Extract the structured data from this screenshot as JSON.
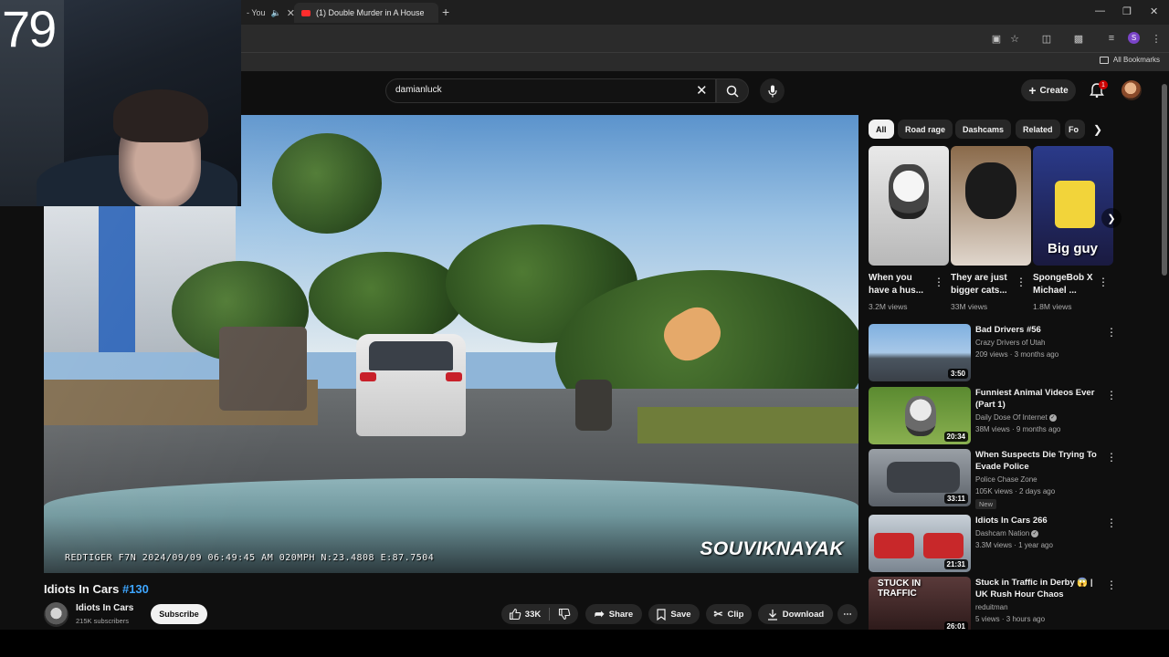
{
  "browser": {
    "tabs": [
      {
        "label": "- You"
      },
      {
        "label": "(1) Double Murder in A House"
      }
    ],
    "new_tab": "+",
    "bookmarks_label": "All Bookmarks",
    "profile_initial": "S"
  },
  "webcam": {
    "counter": "79"
  },
  "header": {
    "search_value": "damianluck",
    "create_label": "Create",
    "notification_count": "1"
  },
  "video": {
    "osd_text": "REDTIGER F7N 2024/09/09 06:49:45 AM 020MPH N:23.4808 E:87.7504",
    "watermark": "SOUVIKNAYAK",
    "title": "Idiots In Cars ",
    "title_tag": "#130",
    "channel": "Idiots In Cars",
    "subscribers": "215K subscribers",
    "subscribe_label": "Subscribe",
    "likes": "33K",
    "share_label": "Share",
    "save_label": "Save",
    "clip_label": "Clip",
    "download_label": "Download"
  },
  "chips": [
    "All",
    "Road rage",
    "Dashcams",
    "Related",
    "Fo"
  ],
  "shorts": [
    {
      "title": "When you have a hus...",
      "views": "3.2M views",
      "overlay": ""
    },
    {
      "title": "They are just bigger cats...",
      "views": "33M views",
      "overlay": ""
    },
    {
      "title": "SpongeBob X Michael ...",
      "views": "1.8M views",
      "overlay": "Big guy"
    }
  ],
  "recommendations": [
    {
      "title": "Bad Drivers #56",
      "channel": "Crazy Drivers of Utah",
      "meta": "209 views · 3 months ago",
      "duration": "3:50",
      "verified": false,
      "is_new": false
    },
    {
      "title": "Funniest Animal Videos Ever (Part 1)",
      "channel": "Daily Dose Of Internet",
      "meta": "38M views · 9 months ago",
      "duration": "20:34",
      "verified": true,
      "is_new": false
    },
    {
      "title": "When Suspects Die Trying To Evade Police",
      "channel": "Police Chase Zone",
      "meta": "105K views · 2 days ago",
      "duration": "33:11",
      "verified": false,
      "is_new": true,
      "new_label": "New"
    },
    {
      "title": "Idiots In Cars 266",
      "channel": "Dashcam Nation",
      "meta": "3.3M views · 1 year ago",
      "duration": "21:31",
      "verified": true,
      "is_new": false
    },
    {
      "title": "Stuck in Traffic in Derby 😱 | UK Rush Hour Chaos",
      "channel": "reduitman",
      "meta": "5 views · 3 hours ago",
      "duration": "26:01",
      "verified": false,
      "is_new": false,
      "thumb_text": "STUCK IN TRAFFIC"
    }
  ],
  "colors": {
    "accent": "#3ea6ff",
    "background": "#0f0f0f",
    "brand_red": "#ff0000"
  }
}
